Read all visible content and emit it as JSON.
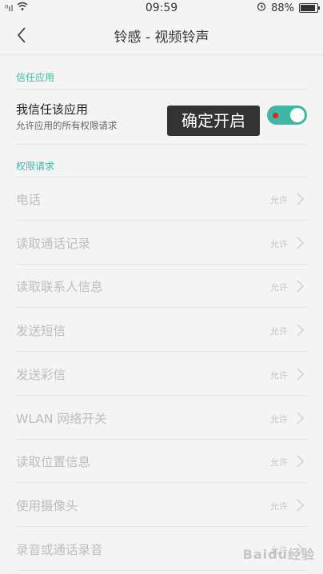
{
  "status_bar": {
    "signal": "⁰ıl",
    "time": "09:59",
    "battery_text": "88%",
    "battery_level": 0.88,
    "icons": [
      "signal-icon",
      "wifi-icon",
      "alarm-icon",
      "battery-icon"
    ]
  },
  "nav": {
    "title": "铃感 - 视频铃声",
    "back_icon": "chevron-left-icon"
  },
  "trust_section": {
    "header": "信任应用",
    "title": "我信任该应用",
    "subtitle": "允许应用的所有权限请求",
    "toggle_on": true,
    "tooltip": "确定开启",
    "accent_color": "#3fb7a3"
  },
  "permissions_section": {
    "header": "权限请求",
    "items": [
      {
        "label": "电话",
        "value": "允许"
      },
      {
        "label": "读取通话记录",
        "value": "允许"
      },
      {
        "label": "读取联系人信息",
        "value": "允许"
      },
      {
        "label": "发送短信",
        "value": "允许"
      },
      {
        "label": "发送彩信",
        "value": "允许"
      },
      {
        "label": "WLAN 网络开关",
        "value": "允许"
      },
      {
        "label": "读取位置信息",
        "value": "允许"
      },
      {
        "label": "使用摄像头",
        "value": "允许"
      },
      {
        "label": "录音或通话录音",
        "value": "允许"
      }
    ]
  },
  "watermark": "Baidu经验"
}
